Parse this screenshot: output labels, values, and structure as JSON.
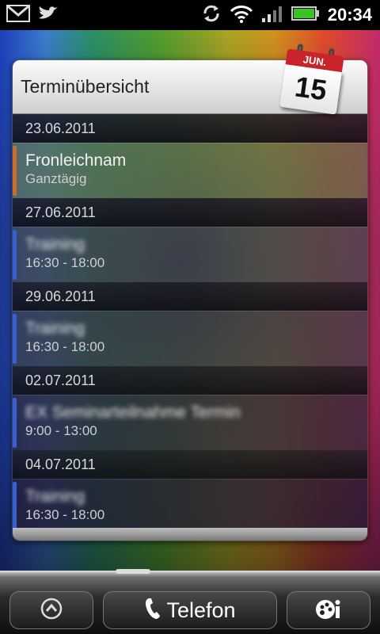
{
  "status_bar": {
    "time": "20:34",
    "icons": [
      "gmail-icon",
      "twitter-bird-icon",
      "sync-icon",
      "wifi-icon",
      "signal-icon",
      "battery-icon"
    ]
  },
  "widget": {
    "title": "Terminübersicht",
    "calendar_icon": {
      "month": "JUN.",
      "day": "15"
    },
    "groups": [
      {
        "date": "23.06.2011",
        "events": [
          {
            "title": "Fronleichnam",
            "time": "Ganztägig",
            "color": "#c8702a",
            "blurred": false
          }
        ]
      },
      {
        "date": "27.06.2011",
        "events": [
          {
            "title": "Training",
            "time": "16:30 - 18:00",
            "color": "#3a5fd0",
            "blurred": true
          }
        ]
      },
      {
        "date": "29.06.2011",
        "events": [
          {
            "title": "Training",
            "time": "16:30 - 18:00",
            "color": "#3a5fd0",
            "blurred": true
          }
        ]
      },
      {
        "date": "02.07.2011",
        "events": [
          {
            "title": "EX Seminarteilnahme Termin",
            "time": "9:00 - 13:00",
            "color": "#3a5fd0",
            "blurred": true
          }
        ]
      },
      {
        "date": "04.07.2011",
        "events": [
          {
            "title": "Training",
            "time": "16:30 - 18:00",
            "color": "#3a5fd0",
            "blurred": true
          }
        ]
      }
    ]
  },
  "dock": {
    "phone_label": "Telefon",
    "buttons": [
      "all-apps-button",
      "phone-button",
      "personalize-button"
    ]
  }
}
